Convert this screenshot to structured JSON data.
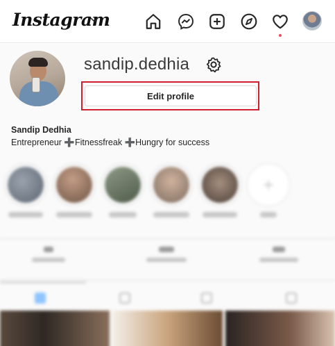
{
  "app": {
    "logo_text": "Instagram"
  },
  "nav": {
    "icons": [
      "home-icon",
      "messenger-icon",
      "new-post-icon",
      "explore-icon",
      "activity-heart-icon",
      "profile-avatar-icon"
    ],
    "notification_dot_color": "#ed4956"
  },
  "profile": {
    "username": "sandip.dedhia",
    "edit_button_label": "Edit profile",
    "full_name": "Sandip Dedhia",
    "bio": "Entrepreneur ➕Fitnessfreak ➕Hungry for success"
  },
  "highlight_color": "#d0202f"
}
